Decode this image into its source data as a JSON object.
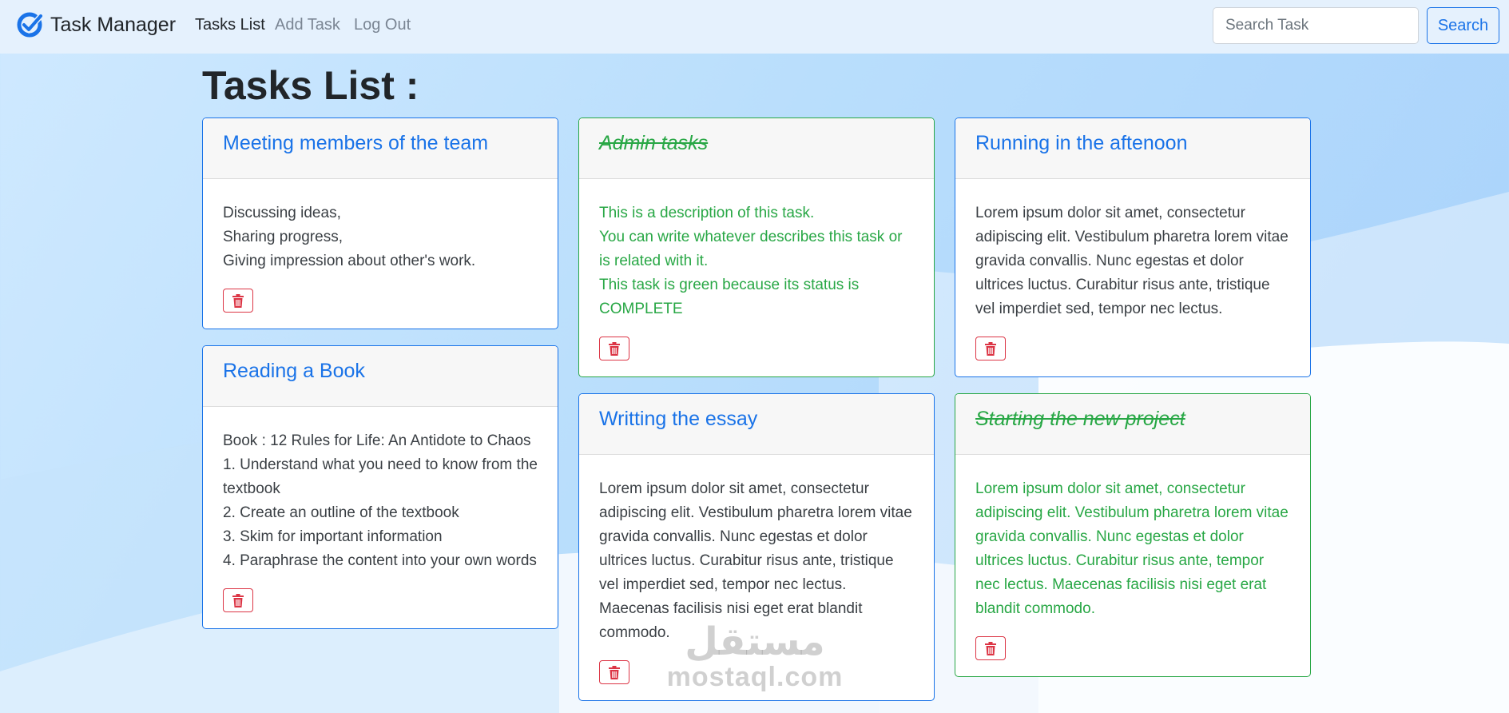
{
  "navbar": {
    "brand": "Task Manager",
    "links": [
      {
        "label": "Tasks List",
        "active": true
      },
      {
        "label": "Add Task",
        "active": false
      },
      {
        "label": "Log Out",
        "active": false
      }
    ],
    "search_placeholder": "Search Task",
    "search_label": "Search"
  },
  "page_title": "Tasks List :",
  "colors": {
    "pending": "#1a73e8",
    "complete": "#28a745",
    "delete": "#dc3545"
  },
  "columns": [
    [
      {
        "title": "Meeting members of the team",
        "status": "pending",
        "lines": [
          "Discussing ideas,",
          "Sharing progress,",
          "Giving impression about other's work."
        ]
      },
      {
        "title": "Reading a Book",
        "status": "pending",
        "lines": [
          "Book : 12 Rules for Life: An Antidote to Chaos",
          "1. Understand what you need to know from the textbook",
          "2. Create an outline of the textbook",
          "3. Skim for important information",
          "4. Paraphrase the content into your own words"
        ]
      }
    ],
    [
      {
        "title": "Admin tasks",
        "status": "complete",
        "lines": [
          "This is a description of this task.",
          "You can write whatever describes this task or is related with it.",
          "This task is green because its status is COMPLETE"
        ]
      },
      {
        "title": "Writting the essay",
        "status": "pending",
        "lines": [
          "Lorem ipsum dolor sit amet, consectetur adipiscing elit. Vestibulum pharetra lorem vitae gravida convallis. Nunc egestas et dolor ultrices luctus. Curabitur risus ante, tristique vel imperdiet sed, tempor nec lectus. Maecenas facilisis nisi eget erat blandit commodo."
        ]
      }
    ],
    [
      {
        "title": "Running in the aftenoon",
        "status": "pending",
        "lines": [
          "Lorem ipsum dolor sit amet, consectetur adipiscing elit. Vestibulum pharetra lorem vitae gravida convallis. Nunc egestas et dolor ultrices luctus. Curabitur risus ante, tristique vel imperdiet sed, tempor nec lectus."
        ]
      },
      {
        "title": "Starting the new project",
        "status": "complete",
        "lines": [
          "Lorem ipsum dolor sit amet, consectetur adipiscing elit. Vestibulum pharetra lorem vitae gravida convallis. Nunc egestas et dolor ultrices luctus. Curabitur risus ante, tempor nec lectus. Maecenas facilisis nisi eget erat blandit commodo."
        ]
      }
    ]
  ],
  "icons": {
    "brand": "check-circle-icon",
    "delete": "trash-icon"
  },
  "watermark": {
    "logo": "مستقل",
    "text": "mostaql.com"
  }
}
